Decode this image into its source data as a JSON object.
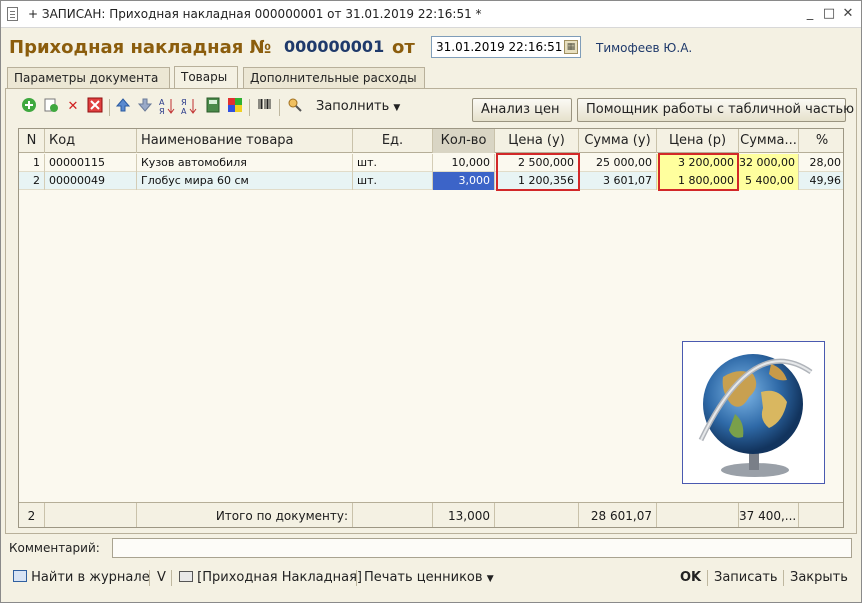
{
  "window": {
    "title": "+ ЗАПИСАН: Приходная накладная 000000001 от 31.01.2019 22:16:51 *",
    "minimize": "_",
    "maximize": "□",
    "close": "✕"
  },
  "header": {
    "doc_title": "Приходная накладная №",
    "doc_number": "000000001",
    "from_label": "от",
    "date": "31.01.2019 22:16:51",
    "author": "Тимофеев Ю.А."
  },
  "tabs": [
    {
      "label": "Параметры документа"
    },
    {
      "label": "Товары"
    },
    {
      "label": "Дополнительные расходы"
    }
  ],
  "toolbar": {
    "fill_label": "Заполнить",
    "price_analysis": "Анализ цен",
    "table_helper": "Помощник работы с табличной частью"
  },
  "table": {
    "columns": [
      "N",
      "Код",
      "Наименование товара",
      "Ед.",
      "Кол-во",
      "Цена (у)",
      "Сумма (у)",
      "Цена (р)",
      "Сумма...",
      "%"
    ],
    "rows": [
      [
        "1",
        "00000115",
        "Кузов автомобиля",
        "шт.",
        "10,000",
        "2 500,000",
        "25 000,00",
        "3 200,000",
        "32 000,00",
        "28,00"
      ],
      [
        "2",
        "00000049",
        "Глобус мира 60 см",
        "шт.",
        "3,000",
        "1 200,356",
        "3 601,07",
        "1 800,000",
        "5 400,00",
        "49,96"
      ]
    ],
    "footer": {
      "count": "2",
      "total_label": "Итого по документу:",
      "qty_total": "13,000",
      "sum_u_total": "28 601,07",
      "sum_r_total": "37 400,..."
    }
  },
  "comment": {
    "label": "Комментарий:",
    "value": ""
  },
  "bottom": {
    "find_in_journal": "Найти в журнале",
    "v": "V",
    "print_form": "[Приходная Накладная]",
    "print_price_tags": "Печать ценников",
    "ok": "OK",
    "save": "Записать",
    "close": "Закрыть"
  },
  "colors": {
    "title_brown": "#8b5d0d",
    "number_blue": "#1f3a6b",
    "highlight_yellow": "#ffff9e",
    "selection_blue": "#3c64c8",
    "annotation_red": "#d22828"
  }
}
